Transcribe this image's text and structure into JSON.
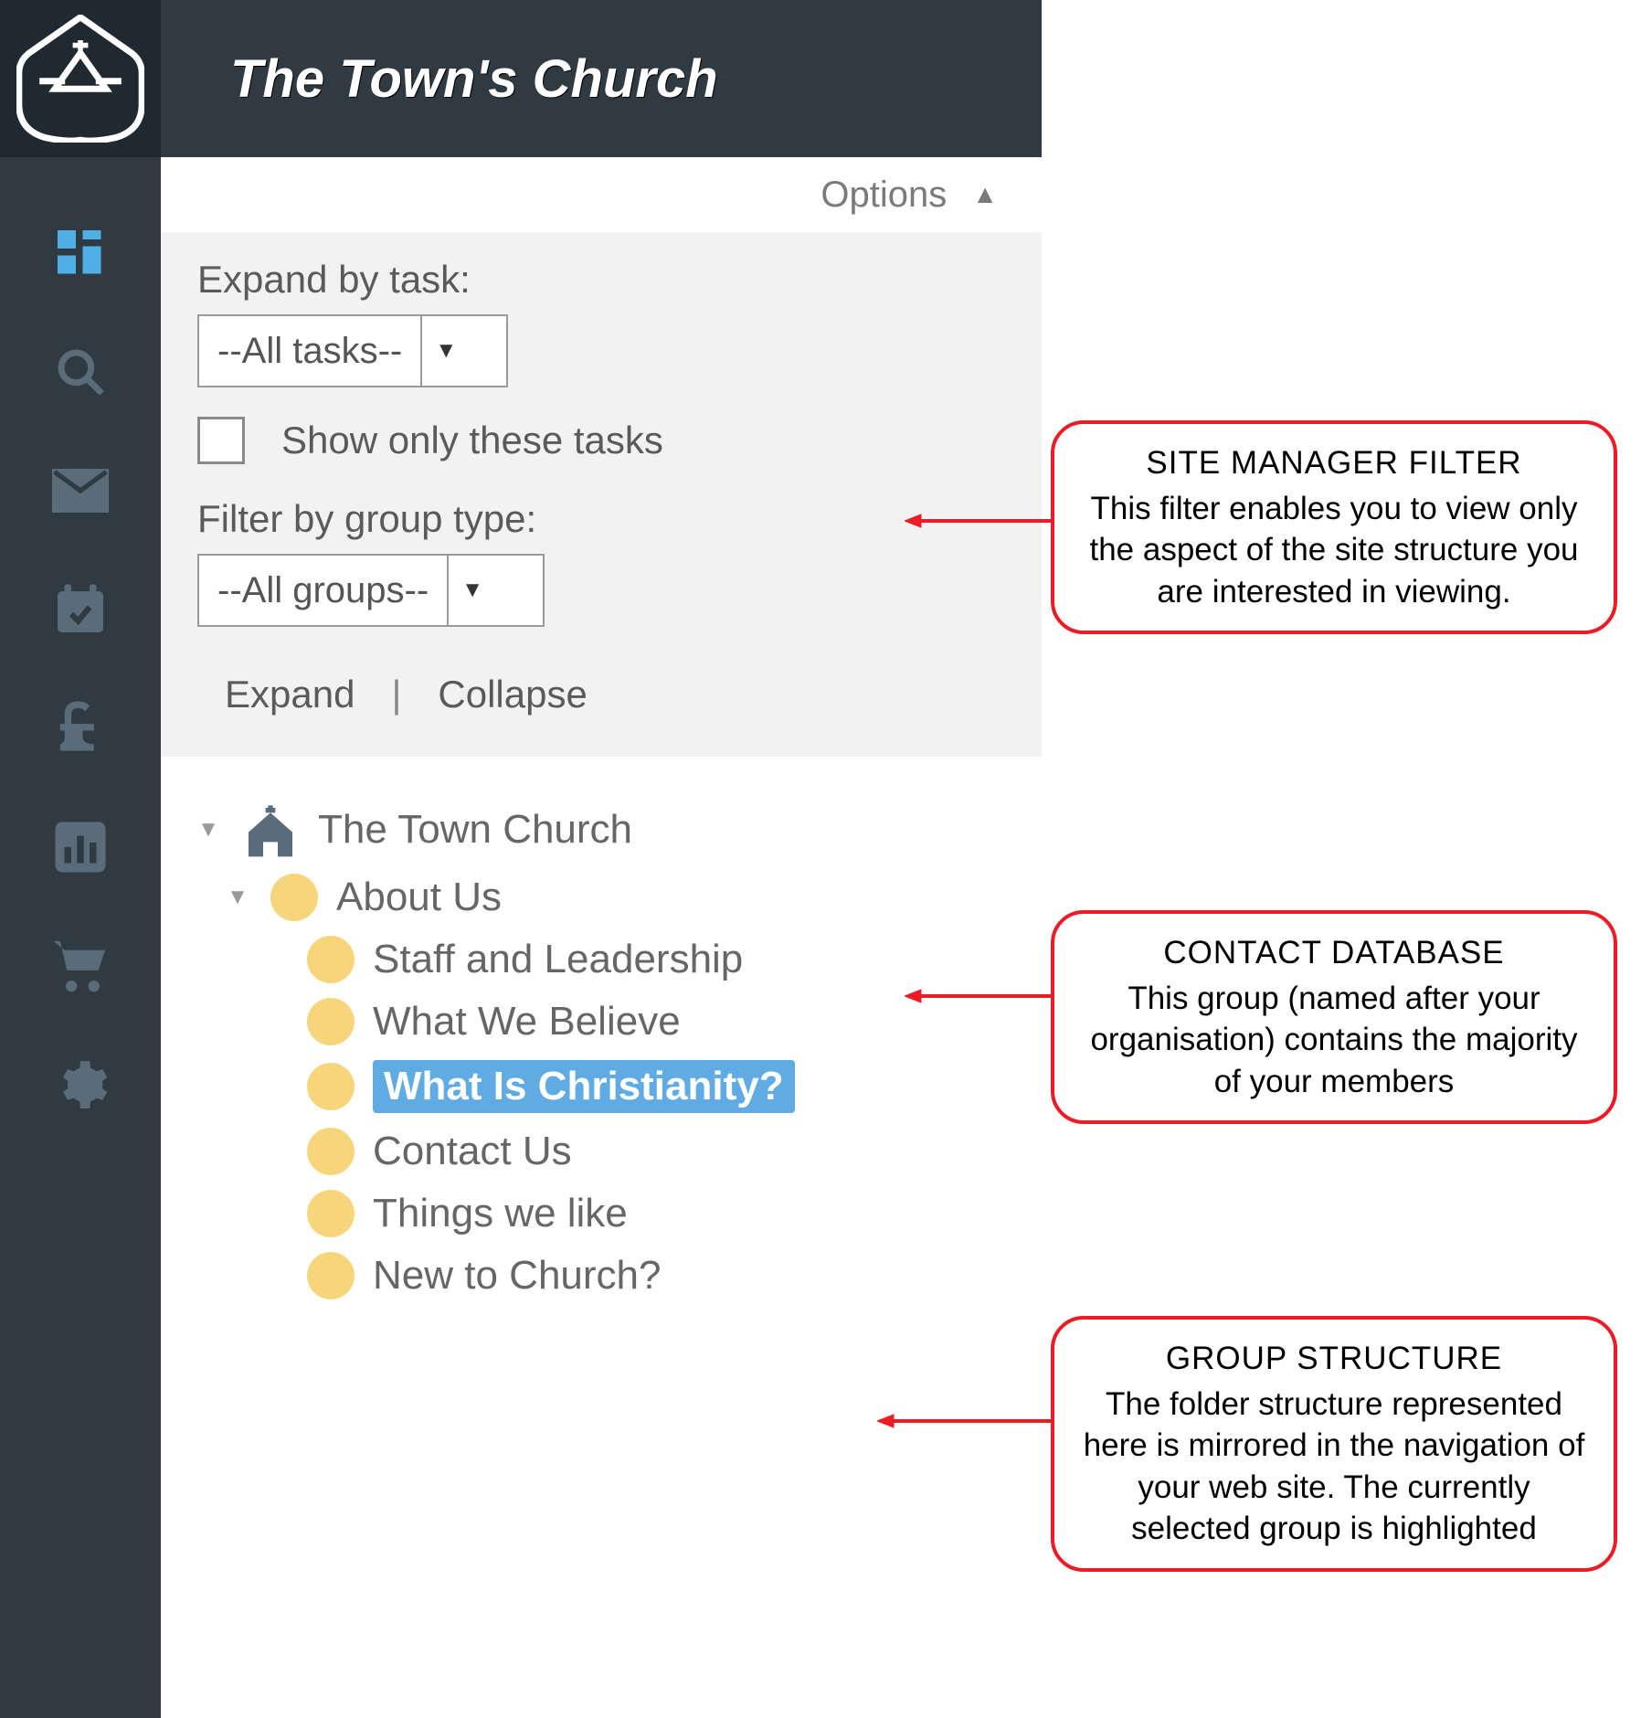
{
  "header": {
    "title": "The Town's Church"
  },
  "options": {
    "label": "Options"
  },
  "filter": {
    "expand_label": "Expand by task:",
    "tasks_value": "--All tasks--",
    "checkbox_label": "Show only these tasks",
    "group_label": "Filter by group type:",
    "groups_value": "--All groups--",
    "expand": "Expand",
    "collapse": "Collapse"
  },
  "tree": {
    "root": "The Town Church",
    "items": [
      {
        "label": "About Us"
      },
      {
        "label": "Staff and Leadership"
      },
      {
        "label": "What We Believe"
      },
      {
        "label": "What Is Christianity?"
      },
      {
        "label": "Contact Us"
      },
      {
        "label": "Things we like"
      },
      {
        "label": "New to Church?"
      }
    ]
  },
  "callouts": {
    "c1": {
      "title": "SITE MANAGER FILTER",
      "body": "This filter enables you to view only the aspect of the site structure you are interested in viewing."
    },
    "c2": {
      "title": "CONTACT DATABASE",
      "body": "This group (named after your organisation) contains the majority of your members"
    },
    "c3": {
      "title": "GROUP STRUCTURE",
      "body": "The folder structure represented here is mirrored in the navigation of your web site. The currently selected group is highlighted"
    }
  }
}
